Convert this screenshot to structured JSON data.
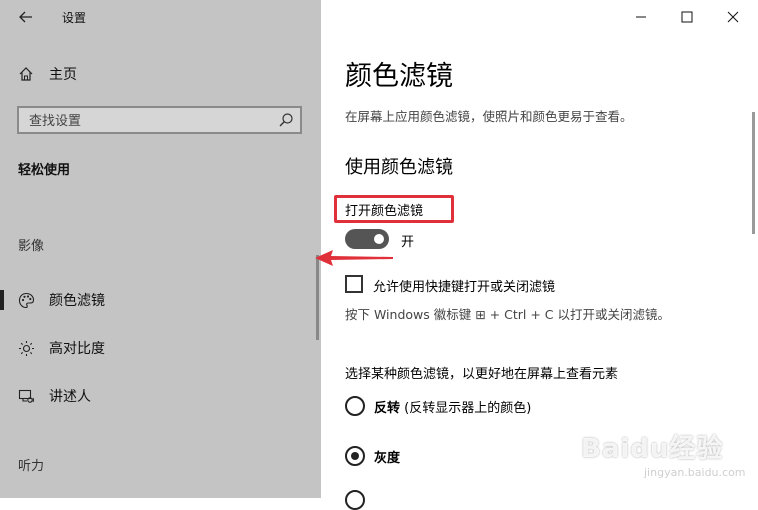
{
  "window": {
    "title": "设置"
  },
  "sidebar": {
    "home_label": "主页",
    "search_placeholder": "查找设置",
    "category": "轻松使用",
    "groups": {
      "vision": "影像",
      "hearing": "听力"
    },
    "items": [
      {
        "label": "颜色滤镜",
        "icon": "palette-icon",
        "selected": true
      },
      {
        "label": "高对比度",
        "icon": "sun-icon",
        "selected": false
      },
      {
        "label": "讲述人",
        "icon": "narrator-icon",
        "selected": false
      }
    ]
  },
  "main": {
    "title": "颜色滤镜",
    "description": "在屏幕上应用颜色滤镜，使照片和颜色更易于查看。",
    "section_title": "使用颜色滤镜",
    "toggle_label": "打开颜色滤镜",
    "toggle_state": "开",
    "shortcut_checkbox_label": "允许使用快捷键打开或关闭滤镜",
    "shortcut_hint": "按下 Windows 徽标键 ⊞ + Ctrl + C 以打开或关闭滤镜。",
    "filter_section_title": "选择某种颜色滤镜，以更好地在屏幕上查看元素",
    "filters": [
      {
        "name": "反转",
        "detail": "(反转显示器上的颜色)",
        "selected": false
      },
      {
        "name": "灰度",
        "detail": "",
        "selected": true
      }
    ]
  },
  "watermark": {
    "text": "Baidu经验",
    "sub": "jingyan.baidu.com"
  },
  "colors": {
    "highlight_box": "#e0313b",
    "sidebar_bg": "#c4c4c4",
    "toggle_on": "#555555"
  }
}
